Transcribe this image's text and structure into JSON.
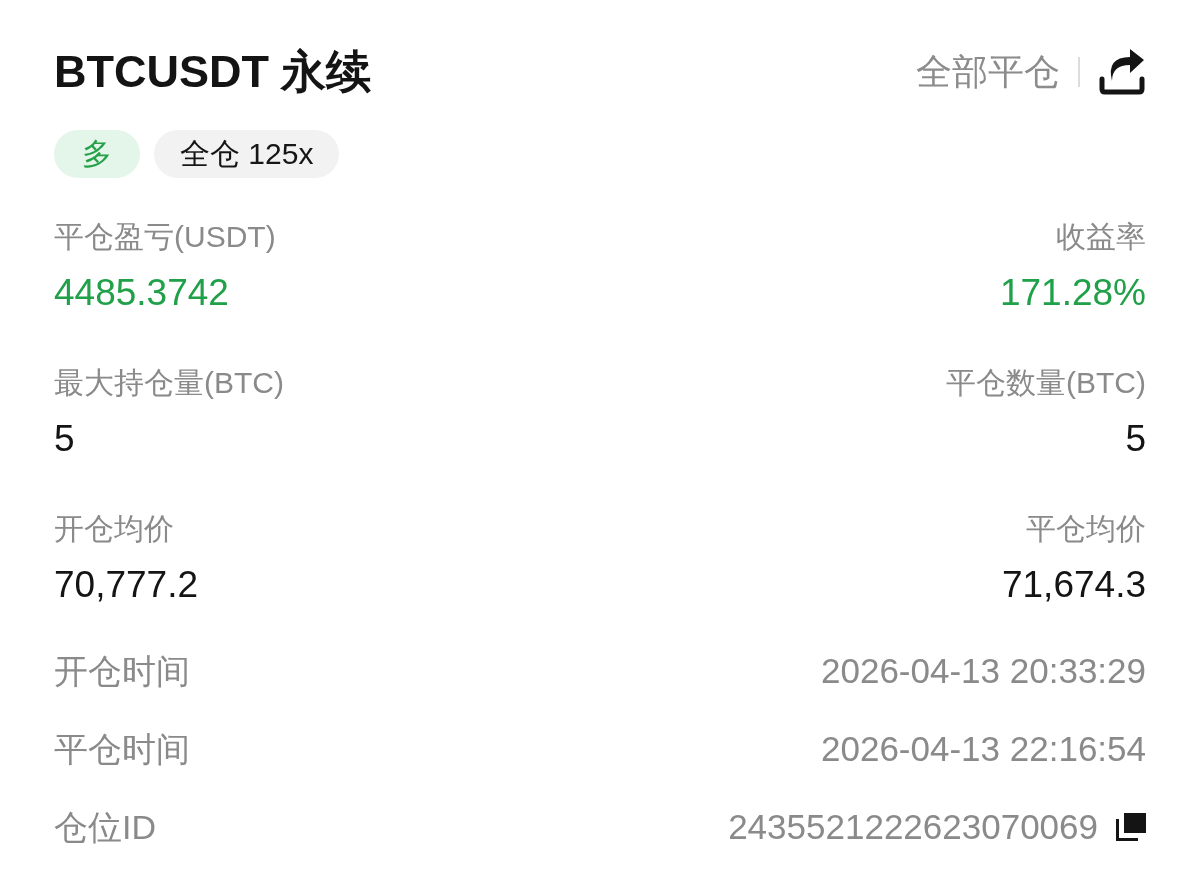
{
  "header": {
    "title": "BTCUSDT 永续",
    "close_all": "全部平仓"
  },
  "tags": [
    {
      "label": "多",
      "kind": "side"
    },
    {
      "label": "全仓 125x",
      "kind": "margin"
    }
  ],
  "stats": [
    {
      "left": {
        "label": "平仓盈亏(USDT)",
        "value": "4485.3742",
        "positive": true
      },
      "right": {
        "label": "收益率",
        "value": "171.28%",
        "positive": true
      }
    },
    {
      "left": {
        "label": "最大持仓量(BTC)",
        "value": "5",
        "positive": false
      },
      "right": {
        "label": "平仓数量(BTC)",
        "value": "5",
        "positive": false
      }
    },
    {
      "left": {
        "label": "开仓均价",
        "value": "70,777.2",
        "positive": false
      },
      "right": {
        "label": "平仓均价",
        "value": "71,674.3",
        "positive": false
      }
    }
  ],
  "details": [
    {
      "label": "开仓时间",
      "value": "2026-04-13 20:33:29",
      "copyable": false
    },
    {
      "label": "平仓时间",
      "value": "2026-04-13 22:16:54",
      "copyable": false
    },
    {
      "label": "仓位ID",
      "value": "2435521222623070069",
      "copyable": true
    }
  ]
}
